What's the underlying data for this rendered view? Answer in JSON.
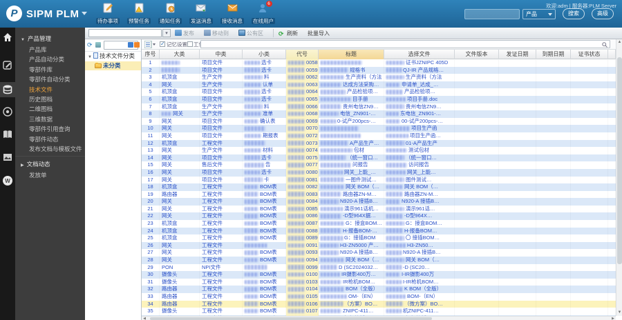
{
  "topbar": {
    "app_title": "SIPM PLM",
    "welcome": "欢迎:adm | 服务器:PLM Server",
    "modules": [
      {
        "label": "待办事项",
        "icon": "todo-icon"
      },
      {
        "label": "预警任务",
        "icon": "alert-task-icon"
      },
      {
        "label": "通知任务",
        "icon": "notify-task-icon"
      },
      {
        "label": "发送消息",
        "icon": "send-message-icon"
      },
      {
        "label": "接收消息",
        "icon": "receive-message-icon"
      },
      {
        "label": "在线用户",
        "icon": "online-users-icon",
        "badge": "6"
      }
    ],
    "search": {
      "value": "",
      "scope": "产品",
      "search_button": "搜索",
      "advanced_button": "高级"
    }
  },
  "toolbar": {
    "publish": "发布",
    "move_to": "移动到",
    "public_area": "公有区",
    "refresh": "刷新",
    "batch_import": "批量导入"
  },
  "sidebar": {
    "group1": {
      "label": "产品管理",
      "expanded": true
    },
    "items": [
      {
        "label": "产品库"
      },
      {
        "label": "产品自动分类"
      },
      {
        "label": "零部件库"
      },
      {
        "label": "零部件自动分类"
      },
      {
        "label": "技术文件",
        "active": true
      },
      {
        "label": "历史图档"
      },
      {
        "label": "二维图档"
      },
      {
        "label": "三维数据"
      },
      {
        "label": "零部件引用查询"
      },
      {
        "label": "零部件动态"
      },
      {
        "label": "发布文档与模板文件"
      }
    ],
    "group2": {
      "label": "文档动态",
      "expanded": false
    },
    "bottom_item": "发放单"
  },
  "tree": {
    "root": "技术文件分类",
    "selected": "未分类"
  },
  "filterbar": {
    "checkbox1": {
      "label": "记忆设置",
      "checked": true
    },
    "checkbox2": {
      "label": "工作区",
      "checked": false
    }
  },
  "table": {
    "columns": [
      "序号",
      "大类",
      "中类",
      "小类",
      "代号",
      "标题",
      "选择文件",
      "文件版本",
      "发证日期",
      "到期日期",
      "证书状态"
    ],
    "rows": [
      {
        "n": 1,
        "cat": {
          "blur": 26,
          "text": ""
        },
        "mid": "项目文件",
        "sub": {
          "blur": 22,
          "text": "选卡"
        },
        "code": {
          "blur": 24,
          "text": "0058"
        },
        "title": {
          "blur": 60,
          "text": ""
        },
        "file": {
          "blur": 26,
          "text": "证书JZNIPC 405D"
        }
      },
      {
        "n": 2,
        "cat": {
          "blur": 26,
          "text": ""
        },
        "mid": "项目文件",
        "sub": {
          "blur": 22,
          "text": "选卡"
        },
        "code": {
          "blur": 24,
          "text": "0059"
        },
        "title": {
          "blur": 40,
          "text": "规格书"
        },
        "file": {
          "blur": 22,
          "text": "QJ-IR 产品规格…"
        }
      },
      {
        "n": 3,
        "cat": {
          "blur": 0,
          "text": "机顶盒"
        },
        "mid": "生产文件",
        "sub": {
          "blur": 26,
          "text": "料"
        },
        "code": {
          "blur": 24,
          "text": "0062"
        },
        "title": {
          "blur": 34,
          "text": "生产资料（方法"
        },
        "file": {
          "blur": 26,
          "text": "生产资料（方法"
        }
      },
      {
        "n": 4,
        "cat": {
          "blur": 0,
          "text": "网关"
        },
        "mid": "生产文件",
        "sub": {
          "blur": 24,
          "text": "认单"
        },
        "code": {
          "blur": 24,
          "text": "0063"
        },
        "title": {
          "blur": 30,
          "text": "达成方法采购…"
        },
        "file": {
          "blur": 20,
          "text": "申请单_达成_…"
        }
      },
      {
        "n": 5,
        "cat": {
          "blur": 0,
          "text": "机顶盒"
        },
        "mid": "项目文件",
        "sub": {
          "blur": 22,
          "text": "选卡"
        },
        "code": {
          "blur": 24,
          "text": "0064"
        },
        "title": {
          "blur": 36,
          "text": "产品检验项…"
        },
        "file": {
          "blur": 24,
          "text": "产品检验项…"
        }
      },
      {
        "n": 6,
        "cat": {
          "blur": 0,
          "text": "机顶盒"
        },
        "mid": "项目文件",
        "sub": {
          "blur": 22,
          "text": "选卡"
        },
        "code": {
          "blur": 24,
          "text": "0065"
        },
        "title": {
          "blur": 44,
          "text": "目手册"
        },
        "file": {
          "blur": 28,
          "text": "项目手册.doc"
        }
      },
      {
        "n": 7,
        "cat": {
          "blur": 0,
          "text": "机顶盒"
        },
        "mid": "生产文件",
        "sub": {
          "blur": 26,
          "text": "料"
        },
        "code": {
          "blur": 24,
          "text": "0066"
        },
        "title": {
          "blur": 30,
          "text": "贵州电信ZN9…"
        },
        "file": {
          "blur": 26,
          "text": "贵州电信ZN9…"
        }
      },
      {
        "n": 8,
        "cat": {
          "blur": 14,
          "text": "网关"
        },
        "mid": "生产文件",
        "sub": {
          "blur": 24,
          "text": "准单"
        },
        "code": {
          "blur": 24,
          "text": "0068"
        },
        "title": {
          "blur": 26,
          "text": "电信_ZN901-…"
        },
        "file": {
          "blur": 18,
          "text": "东电信_ZN901-…"
        }
      },
      {
        "n": 9,
        "cat": {
          "blur": 0,
          "text": "网关"
        },
        "mid": "项目文件",
        "sub": {
          "blur": 20,
          "text": "确认表"
        },
        "code": {
          "blur": 24,
          "text": "0069"
        },
        "title": {
          "blur": 22,
          "text": "0-试产200pcs-…"
        },
        "file": {
          "blur": 20,
          "text": "00-试产200pcs-…"
        }
      },
      {
        "n": 10,
        "cat": {
          "blur": 0,
          "text": "网关"
        },
        "mid": "项目文件",
        "sub": {
          "blur": 30,
          "text": ""
        },
        "code": {
          "blur": 24,
          "text": "0070"
        },
        "title": {
          "blur": 55,
          "text": ""
        },
        "file": {
          "blur": 34,
          "text": "项目生产函"
        }
      },
      {
        "n": 11,
        "cat": {
          "blur": 0,
          "text": "网关"
        },
        "mid": "项目文件",
        "sub": {
          "blur": 24,
          "text": "期报表"
        },
        "code": {
          "blur": 24,
          "text": "0072"
        },
        "title": {
          "blur": 58,
          "text": ""
        },
        "file": {
          "blur": 32,
          "text": "项目生产函…"
        }
      },
      {
        "n": 12,
        "cat": {
          "blur": 0,
          "text": "机顶盒"
        },
        "mid": "工程文件",
        "sub": {
          "blur": 30,
          "text": ""
        },
        "code": {
          "blur": 24,
          "text": "0073"
        },
        "title": {
          "blur": 40,
          "text": "A产品生产…"
        },
        "file": {
          "blur": 26,
          "text": "01-A产品生产"
        }
      },
      {
        "n": 13,
        "cat": {
          "blur": 0,
          "text": "网关"
        },
        "mid": "生产文件",
        "sub": {
          "blur": 24,
          "text": "材料"
        },
        "code": {
          "blur": 24,
          "text": "0074"
        },
        "title": {
          "blur": 46,
          "text": "包材"
        },
        "file": {
          "blur": 30,
          "text": "测试包材"
        }
      },
      {
        "n": 14,
        "cat": {
          "blur": 0,
          "text": "网关"
        },
        "mid": "项目文件",
        "sub": {
          "blur": 22,
          "text": "选卡"
        },
        "code": {
          "blur": 24,
          "text": "0075"
        },
        "title": {
          "blur": 36,
          "text": "（统一窗口…"
        },
        "file": {
          "blur": 26,
          "text": "（统一窗口…"
        }
      },
      {
        "n": 15,
        "cat": {
          "blur": 0,
          "text": "网关"
        },
        "mid": "售后文件",
        "sub": {
          "blur": 28,
          "text": "告"
        },
        "code": {
          "blur": 24,
          "text": "0077"
        },
        "title": {
          "blur": 44,
          "text": "问报告"
        },
        "file": {
          "blur": 30,
          "text": "访问报告"
        }
      },
      {
        "n": 16,
        "cat": {
          "blur": 0,
          "text": "网关"
        },
        "mid": "项目文件",
        "sub": {
          "blur": 22,
          "text": "选卡"
        },
        "code": {
          "blur": 24,
          "text": "0080"
        },
        "title": {
          "blur": 32,
          "text": "网关_上能_…"
        },
        "file": {
          "blur": 28,
          "text": "网关_上能…"
        }
      },
      {
        "n": 17,
        "cat": {
          "blur": 0,
          "text": "网关"
        },
        "mid": "项目文件",
        "sub": {
          "blur": 26,
          "text": "卡"
        },
        "code": {
          "blur": 24,
          "text": "0081"
        },
        "title": {
          "blur": 34,
          "text": "一图件测试…"
        },
        "file": {
          "blur": 26,
          "text": "图件测试…"
        }
      },
      {
        "n": 18,
        "cat": {
          "blur": 0,
          "text": "机顶盒"
        },
        "mid": "工程文件",
        "sub": {
          "blur": 20,
          "text": "BOM表"
        },
        "code": {
          "blur": 24,
          "text": "0082"
        },
        "title": {
          "blur": 34,
          "text": "网关 BOM（…"
        },
        "file": {
          "blur": 24,
          "text": "网关 BOM（…"
        }
      },
      {
        "n": 19,
        "cat": {
          "blur": 0,
          "text": "路由器"
        },
        "mid": "工程文件",
        "sub": {
          "blur": 20,
          "text": "BOM表"
        },
        "code": {
          "blur": 24,
          "text": "0083"
        },
        "title": {
          "blur": 30,
          "text": "路由器ZN-M…"
        },
        "file": {
          "blur": 24,
          "text": "路由器ZN-M…"
        }
      },
      {
        "n": 20,
        "cat": {
          "blur": 0,
          "text": "网关"
        },
        "mid": "工程文件",
        "sub": {
          "blur": 20,
          "text": "BOM表"
        },
        "code": {
          "blur": 24,
          "text": "0084"
        },
        "title": {
          "blur": 26,
          "text": "N920-A 接插B…"
        },
        "file": {
          "blur": 20,
          "text": "N920-A 接插B…"
        }
      },
      {
        "n": 21,
        "cat": {
          "blur": 0,
          "text": "网关"
        },
        "mid": "工程文件",
        "sub": {
          "blur": 20,
          "text": "BOM表"
        },
        "code": {
          "blur": 24,
          "text": "0085"
        },
        "title": {
          "blur": 32,
          "text": "演示961话机…"
        },
        "file": {
          "blur": 26,
          "text": "演示961话…"
        }
      },
      {
        "n": 22,
        "cat": {
          "blur": 0,
          "text": "网关"
        },
        "mid": "工程文件",
        "sub": {
          "blur": 20,
          "text": "BOM表"
        },
        "code": {
          "blur": 24,
          "text": "0086"
        },
        "title": {
          "blur": 30,
          "text": "-D型964X据…"
        },
        "file": {
          "blur": 24,
          "text": "-D型964X…"
        }
      },
      {
        "n": 23,
        "cat": {
          "blur": 0,
          "text": "机顶盒"
        },
        "mid": "工程文件",
        "sub": {
          "blur": 20,
          "text": "BOM表"
        },
        "code": {
          "blur": 24,
          "text": "0087"
        },
        "title": {
          "blur": 34,
          "text": "G：接盒BOM…"
        },
        "file": {
          "blur": 26,
          "text": "G：接盒BOM…"
        }
      },
      {
        "n": 24,
        "cat": {
          "blur": 0,
          "text": "机顶盒"
        },
        "mid": "工程文件",
        "sub": {
          "blur": 20,
          "text": "BOM表"
        },
        "code": {
          "blur": 24,
          "text": "0088"
        },
        "title": {
          "blur": 30,
          "text": "H-报备BOM-…"
        },
        "file": {
          "blur": 24,
          "text": "H-报备BOM…"
        }
      },
      {
        "n": 25,
        "cat": {
          "blur": 0,
          "text": "机顶盒"
        },
        "mid": "工程文件",
        "sub": {
          "blur": 20,
          "text": "BOM表"
        },
        "code": {
          "blur": 24,
          "text": "0089"
        },
        "title": {
          "blur": 32,
          "text": "G：接插BOM"
        },
        "file": {
          "blur": 26,
          "text": "〇 接插BOM…"
        }
      },
      {
        "n": 26,
        "cat": {
          "blur": 0,
          "text": "网关"
        },
        "mid": "工程文件",
        "sub": {
          "blur": 32,
          "text": ""
        },
        "code": {
          "blur": 24,
          "text": "0091"
        },
        "title": {
          "blur": 26,
          "text": "H3-ZN5000 产…"
        },
        "file": {
          "blur": 28,
          "text": "H3-ZN50…"
        }
      },
      {
        "n": 27,
        "cat": {
          "blur": 0,
          "text": "网关"
        },
        "mid": "工程文件",
        "sub": {
          "blur": 20,
          "text": "BOM表"
        },
        "code": {
          "blur": 24,
          "text": "0093"
        },
        "title": {
          "blur": 26,
          "text": "N920-A 接插B…"
        },
        "file": {
          "blur": 22,
          "text": "N920-A 接插B…"
        }
      },
      {
        "n": 28,
        "cat": {
          "blur": 0,
          "text": "网关"
        },
        "mid": "工程文件",
        "sub": {
          "blur": 20,
          "text": "BOM表"
        },
        "code": {
          "blur": 24,
          "text": "0094"
        },
        "title": {
          "blur": 34,
          "text": "网关 BOM（…"
        },
        "file": {
          "blur": 26,
          "text": "网关 BOM（…"
        }
      },
      {
        "n": 29,
        "cat": {
          "blur": 0,
          "text": "PON"
        },
        "mid": "NPI文件",
        "sub": {
          "blur": 32,
          "text": ""
        },
        "code": {
          "blur": 24,
          "text": "0099"
        },
        "title": {
          "blur": 24,
          "text": "D (SC2024032…"
        },
        "file": {
          "blur": 22,
          "text": "-D (SC20…"
        }
      },
      {
        "n": 30,
        "cat": {
          "blur": 0,
          "text": "摄像头"
        },
        "mid": "工程文件",
        "sub": {
          "blur": 20,
          "text": "BOM表"
        },
        "code": {
          "blur": 24,
          "text": "0100"
        },
        "title": {
          "blur": 28,
          "text": "IR摄影400万…"
        },
        "file": {
          "blur": 20,
          "text": "I-IR摄影400万"
        }
      },
      {
        "n": 31,
        "cat": {
          "blur": 0,
          "text": "摄像头"
        },
        "mid": "工程文件",
        "sub": {
          "blur": 20,
          "text": "BOM表"
        },
        "code": {
          "blur": 24,
          "text": "0103"
        },
        "title": {
          "blur": 30,
          "text": "IR枪机BOM…"
        },
        "file": {
          "blur": 22,
          "text": "I-IR枪机BOM…"
        }
      },
      {
        "n": 32,
        "cat": {
          "blur": 0,
          "text": "路由器"
        },
        "mid": "工程文件",
        "sub": {
          "blur": 20,
          "text": "BOM表"
        },
        "code": {
          "blur": 24,
          "text": "0104"
        },
        "title": {
          "blur": 34,
          "text": "BOM（全版）"
        },
        "file": {
          "blur": 24,
          "text": "K BOM（全版）"
        }
      },
      {
        "n": 33,
        "cat": {
          "blur": 0,
          "text": "路由器"
        },
        "mid": "工程文件",
        "sub": {
          "blur": 20,
          "text": "BOM表"
        },
        "code": {
          "blur": 24,
          "text": "0105"
        },
        "title": {
          "blur": 38,
          "text": "OM-（EN）"
        },
        "file": {
          "blur": 28,
          "text": "BOM-（EN）"
        }
      },
      {
        "n": 34,
        "cat": {
          "blur": 0,
          "text": "路由器"
        },
        "mid": "工程文件",
        "sub": {
          "blur": 20,
          "text": "BOM表"
        },
        "code": {
          "blur": 24,
          "text": "0106"
        },
        "title": {
          "blur": 32,
          "text": "（方案）BO…"
        },
        "file": {
          "blur": 24,
          "text": "（微方案）BO…"
        },
        "highlight": true
      },
      {
        "n": 35,
        "cat": {
          "blur": 0,
          "text": "摄像头"
        },
        "mid": "工程文件",
        "sub": {
          "blur": 20,
          "text": "BOM表"
        },
        "code": {
          "blur": 24,
          "text": "0107"
        },
        "title": {
          "blur": 30,
          "text": "ZNIPC-411…"
        },
        "file": {
          "blur": 22,
          "text": "机ZNIPC-411…"
        }
      },
      {
        "n": 36,
        "cat": {
          "blur": 0,
          "text": "网关"
        },
        "mid": "工程文件",
        "sub": {
          "blur": 20,
          "text": "BOM表"
        },
        "code": {
          "blur": 24,
          "text": "0108"
        },
        "title": {
          "blur": 30,
          "text": "方案 接插B…"
        },
        "file": {
          "blur": 24,
          "text": "方案 接插B…"
        }
      }
    ]
  },
  "colors": {
    "topbar_blue": "#25709f",
    "link_blue": "#2b51c8",
    "row_stripe": "#dbe8f8",
    "code_column": "#fcf4c4",
    "title_header": "#f3d795",
    "selected_row": "#fcf3bb",
    "active_menu": "#f0a43c"
  }
}
